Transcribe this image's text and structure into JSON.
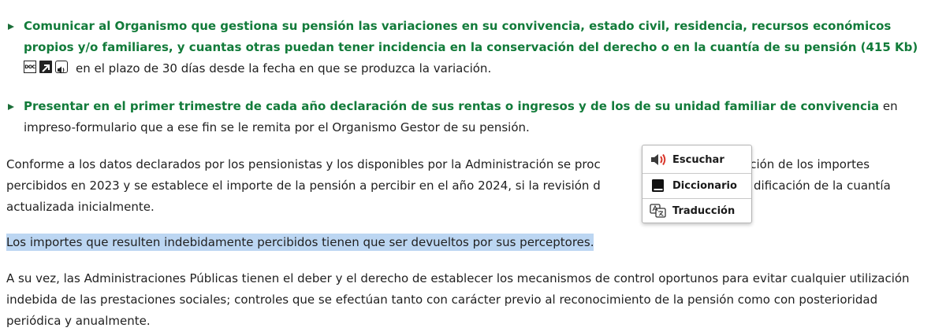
{
  "bullets": [
    {
      "link_text": "Comunicar al Organismo que gestiona su pensión las variaciones en su convivencia, estado civil, residencia, recursos económicos propios y/o familiares, y cuantas otras puedan tener incidencia en la conservación del derecho o en la cuantía de su pensión (415 Kb)",
      "trailing_text": "en el plazo de 30 días desde la fecha en que se produzca la variación.",
      "icons": [
        "doc-file-icon",
        "external-link-icon",
        "audio-icon"
      ],
      "doc_icon_text": "DOC"
    },
    {
      "link_text": "Presentar en el primer trimestre de cada año declaración de sus rentas o ingresos y de los de su unidad familiar de convivencia",
      "trailing_text": " en impreso-formulario que a ese fin se le remita por el Organismo Gestor de su pensión."
    }
  ],
  "paragraphs": {
    "p1_line1_a": "Conforme a los datos declarados por los pensionistas y los disponibles por la Administración se proc",
    "p1_line1_b": "ación de los importes",
    "p1_line2_a": "percibidos en 2023 y se establece el importe de la pensión a percibir en el año 2024, si la revisión d",
    "p1_line2_b": "dificación de la cuantía",
    "p1_line3": "actualizada inicialmente.",
    "p2": "Los importes que resulten indebidamente percibidos tienen que ser devueltos por sus perceptores.",
    "p3": "A su vez, las Administraciones Públicas tienen el deber y el derecho de establecer los mecanismos de control oportunos para evitar cualquier utilización indebida de las prestaciones sociales; controles que se efectúan tanto con carácter previo al reconocimiento de la pensión como con posterioridad periódica y anualmente."
  },
  "context_menu": {
    "items": [
      {
        "label": "Escuchar",
        "icon": "speaker-icon"
      },
      {
        "label": "Diccionario",
        "icon": "book-icon"
      },
      {
        "label": "Traducción",
        "icon": "translate-icon"
      }
    ]
  },
  "colors": {
    "link_green": "#127b3a",
    "selection": "#bcd6f2",
    "speaker_red": "#d9362b"
  }
}
